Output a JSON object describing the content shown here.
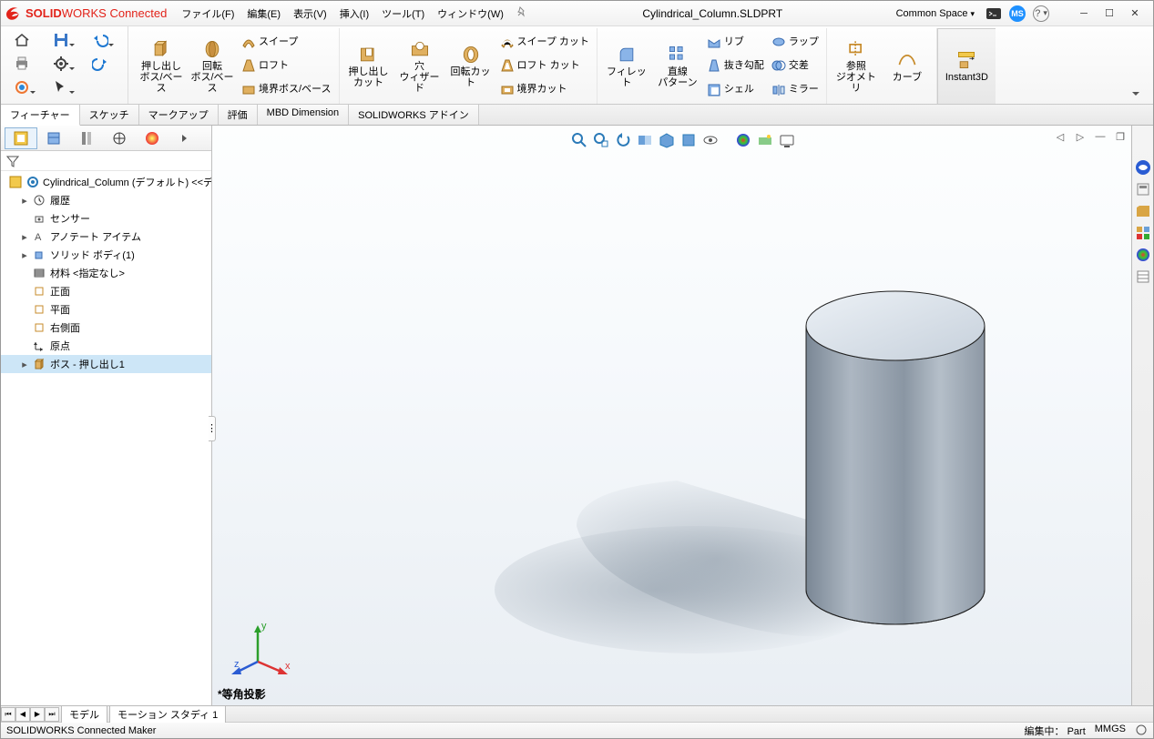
{
  "app": {
    "name_bold": "SOLID",
    "name_thin": "WORKS Connected",
    "file_title": "Cylindrical_Column.SLDPRT",
    "workspace": "Common Space",
    "user_initials": "MS"
  },
  "menu": {
    "file": "ファイル(F)",
    "edit": "編集(E)",
    "view": "表示(V)",
    "insert": "挿入(I)",
    "tools": "ツール(T)",
    "window": "ウィンドウ(W)"
  },
  "ribbon": {
    "extrude": "押し出し\nボス/ベース",
    "revolve": "回転\nボス/ベース",
    "sweep": "スイープ",
    "loft": "ロフト",
    "boundary": "境界ボス/ベース",
    "cut_extrude": "押し出し\nカット",
    "hole": "穴\nウィザード",
    "rev_cut": "回転カット",
    "sweep_cut": "スイープ カット",
    "loft_cut": "ロフト カット",
    "boundary_cut": "境界カット",
    "fillet": "フィレット",
    "linpat": "直線\nパターン",
    "rib": "リブ",
    "draft": "抜き勾配",
    "shell": "シェル",
    "wrap": "ラップ",
    "intersect": "交差",
    "mirror": "ミラー",
    "refgeo": "参照\nジオメトリ",
    "curves": "カーブ",
    "instant3d": "Instant3D"
  },
  "tabs": {
    "feature": "フィーチャー",
    "sketch": "スケッチ",
    "markup": "マークアップ",
    "evaluate": "評価",
    "mbd": "MBD Dimension",
    "addins": "SOLIDWORKS アドイン"
  },
  "tree": {
    "root": "Cylindrical_Column (デフォルト) <<デ",
    "history": "履歴",
    "sensors": "センサー",
    "annotations": "アノテート アイテム",
    "solid_bodies": "ソリッド ボディ(1)",
    "material": "材料 <指定なし>",
    "front": "正面",
    "top": "平面",
    "right": "右側面",
    "origin": "原点",
    "feature1": "ボス - 押し出し1"
  },
  "viewport": {
    "view_label": "*等角投影"
  },
  "bottom": {
    "model": "モデル",
    "motion": "モーション スタディ 1"
  },
  "status": {
    "left": "SOLIDWORKS Connected Maker",
    "edit": "編集中：",
    "edit_target": "Part",
    "units": "MMGS"
  }
}
